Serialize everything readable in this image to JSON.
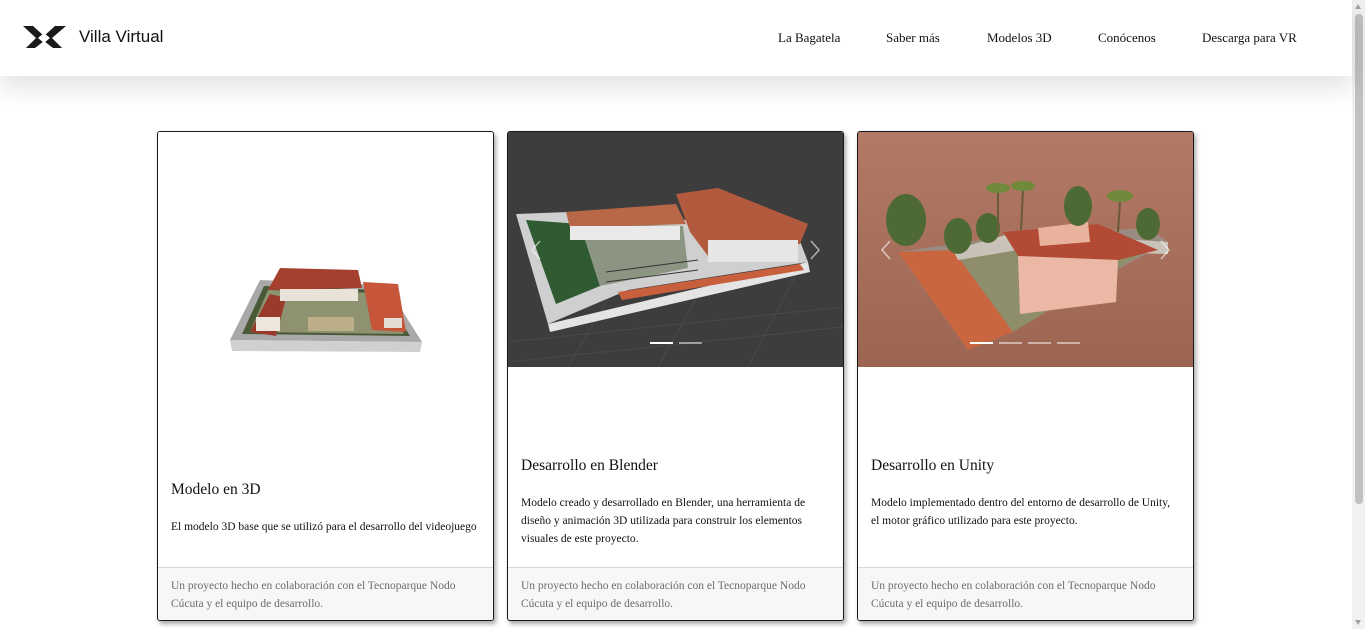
{
  "brand": {
    "title": "Villa Virtual",
    "logo": "vv-logo"
  },
  "nav": {
    "items": [
      "La Bagatela",
      "Saber más",
      "Modelos 3D",
      "Conócenos",
      "Descarga para VR"
    ]
  },
  "cards": [
    {
      "title": "Modelo en 3D",
      "text": "El modelo 3D base que se utilizó para el desarrollo del videojuego",
      "footer": "Un proyecto hecho en colaboración con el Tecnoparque Nodo Cúcuta y el equipo de desarrollo."
    },
    {
      "title": "Desarrollo en Blender",
      "text": "Modelo creado y desarrollado en Blender, una herramienta de diseño y animación 3D utilizada para construir los elementos visuales de este proyecto.",
      "footer": "Un proyecto hecho en colaboración con el Tecnoparque Nodo Cúcuta y el equipo de desarrollo.",
      "carousel": {
        "slides": 2,
        "active": 1
      }
    },
    {
      "title": "Desarrollo en Unity",
      "text": "Modelo implementado dentro del entorno de desarrollo de Unity, el motor gráfico utilizado para este proyecto.",
      "footer": "Un proyecto hecho en colaboración con el Tecnoparque Nodo Cúcuta y el equipo de desarrollo.",
      "carousel": {
        "slides": 4,
        "active": 1
      }
    }
  ],
  "colors": {
    "roof": "#b85a3f",
    "blender_bg": "#3d3d3d",
    "unity_bg": "#a56e5c",
    "footer_text": "#6c6c6c"
  },
  "icons": [
    "vv-logo",
    "chevron-left-icon",
    "chevron-right-icon"
  ]
}
